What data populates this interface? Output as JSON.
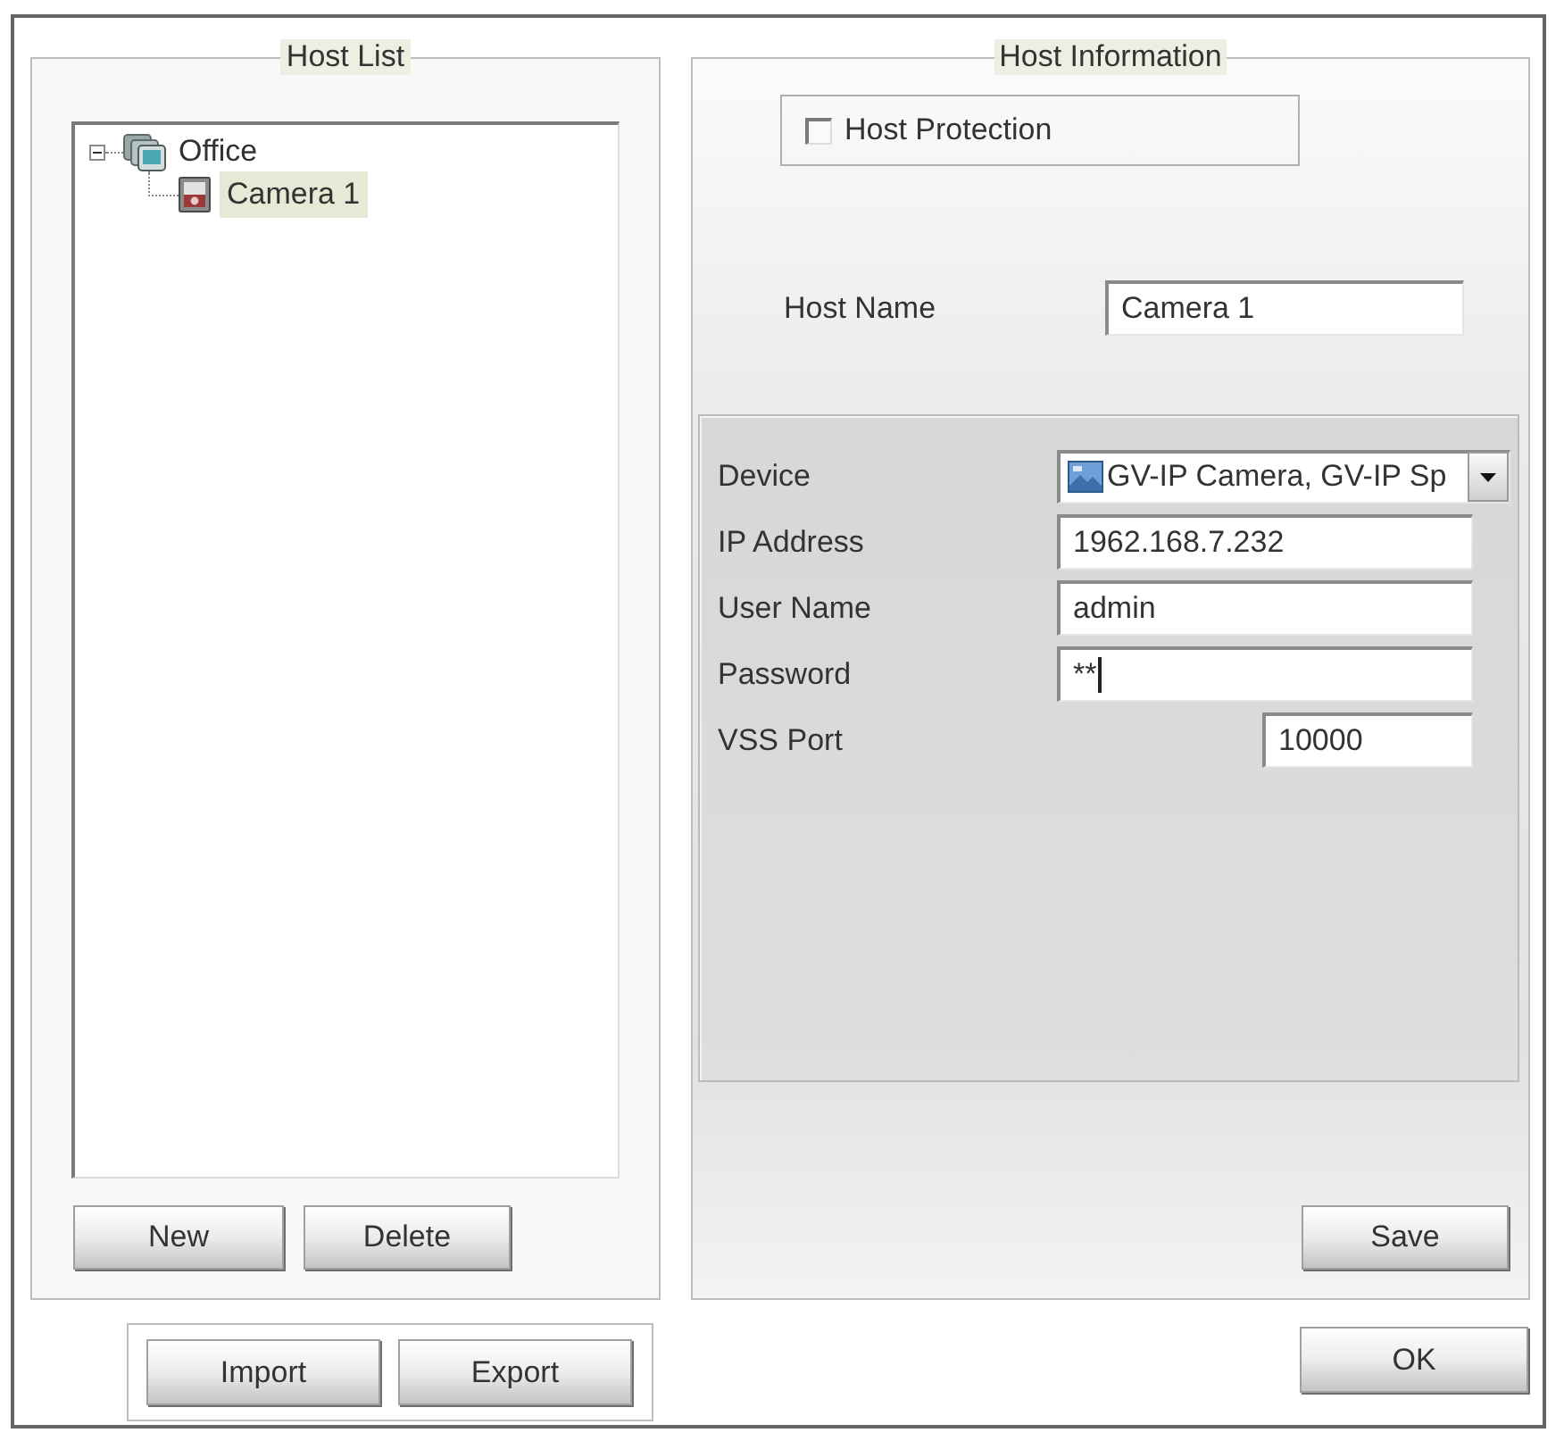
{
  "host_list": {
    "title": "Host List",
    "tree": [
      {
        "label": "Office",
        "kind": "group",
        "expanded": true,
        "selected": false,
        "children": [
          {
            "label": "Camera 1",
            "kind": "camera",
            "selected": true
          }
        ]
      }
    ],
    "buttons": [
      "New",
      "Delete"
    ]
  },
  "import_export": {
    "buttons": [
      "Import",
      "Export"
    ]
  },
  "host_information": {
    "title": "Host Information",
    "host_protection": {
      "label": "Host Protection",
      "checked": false
    },
    "host_name": {
      "label": "Host Name",
      "value": "Camera 1"
    },
    "connection_fields": [
      {
        "kind": "select",
        "label": "Device",
        "value": "GV-IP Camera, GV-IP Sp",
        "focused": false
      },
      {
        "kind": "text",
        "label": "IP Address",
        "value": "1962.168.7.232",
        "focused": false
      },
      {
        "kind": "text",
        "label": "User Name",
        "value": "admin",
        "focused": false
      },
      {
        "kind": "password",
        "label": "Password",
        "value": "**",
        "focused": true
      },
      {
        "kind": "number",
        "label": "VSS Port",
        "value": "10000",
        "focused": false
      }
    ],
    "save_button": "Save"
  },
  "ok_button": "OK"
}
